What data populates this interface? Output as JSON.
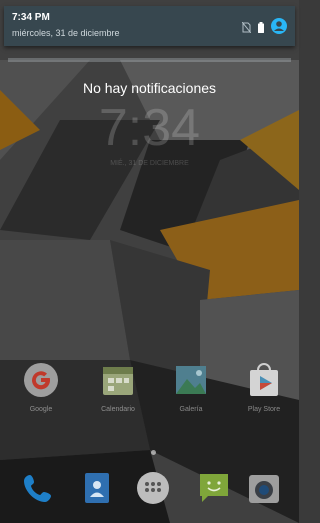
{
  "status": {
    "time": "7:34 PM",
    "date": "miércoles, 31 de diciembre"
  },
  "lockscreen": {
    "message": "No hay notificaciones",
    "clock": "7:34",
    "clock_date": "MIÉ., 31 DE DICIEMBRE"
  },
  "apps": [
    {
      "label": "Google",
      "icon": "google-icon"
    },
    {
      "label": "Calendario",
      "icon": "calendar-icon"
    },
    {
      "label": "Galería",
      "icon": "gallery-icon"
    },
    {
      "label": "Play Store",
      "icon": "play-store-icon"
    }
  ],
  "dock": [
    {
      "icon": "phone-icon"
    },
    {
      "icon": "contacts-icon"
    },
    {
      "icon": "app-drawer-icon"
    },
    {
      "icon": "messaging-icon"
    },
    {
      "icon": "camera-icon"
    }
  ],
  "colors": {
    "shade": "#37474f",
    "accent": "#29b6f6",
    "wallpaper_orange": "#f5a623"
  }
}
